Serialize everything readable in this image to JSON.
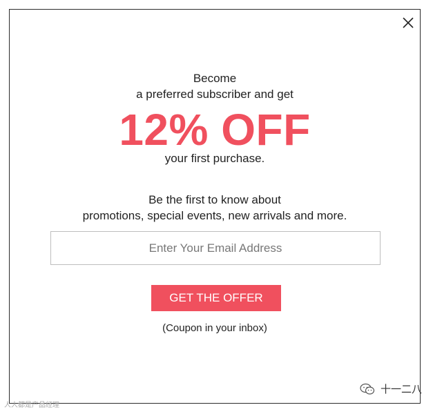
{
  "colors": {
    "accent": "#f0505e",
    "text": "#222222",
    "border": "#bdbdbd"
  },
  "popup": {
    "close_icon": "close-icon",
    "line_become": "Become",
    "line_preferred": "a preferred subscriber and get",
    "headline": "12% OFF",
    "line_first_purchase": "your first purchase.",
    "line_be_first": "Be the first to know about",
    "line_promotions": "promotions, special events, new arrivals and more.",
    "email": {
      "value": "",
      "placeholder": "Enter Your Email Address"
    },
    "cta_label": "GET THE OFFER",
    "coupon_note": "(Coupon in your inbox)"
  },
  "watermark": {
    "icon": "wechat-icon",
    "right_text": "十一二八",
    "left_text": "人人都是产品经理"
  }
}
